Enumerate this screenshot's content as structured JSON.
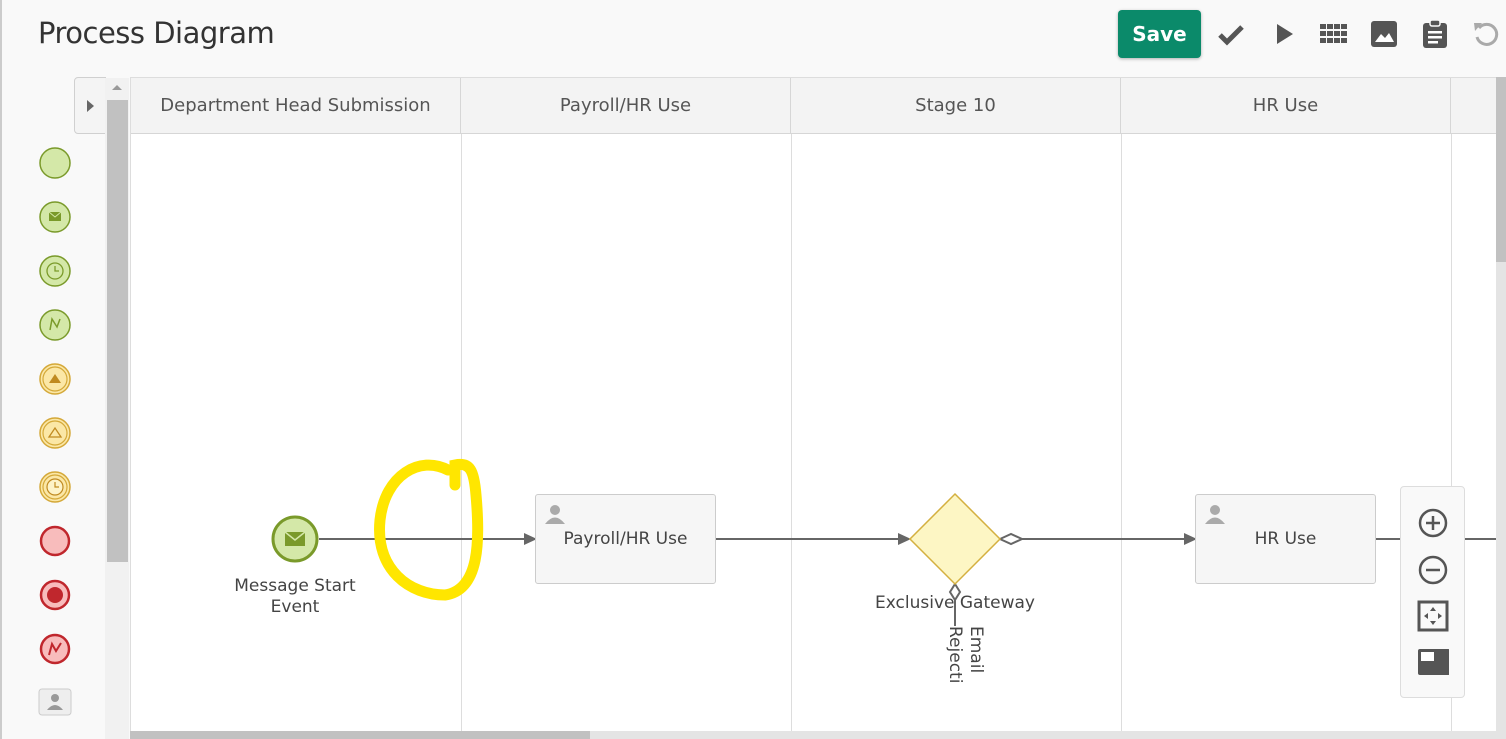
{
  "header": {
    "title": "Process Diagram",
    "save_label": "Save"
  },
  "toolbar": {
    "icons": [
      "check-icon",
      "play-icon",
      "grid-icon",
      "image-icon",
      "clipboard-icon",
      "undo-icon"
    ]
  },
  "palette": {
    "items": [
      "start-event",
      "message-start-event",
      "timer-start-event",
      "signal-start-event",
      "escalation-event-filled",
      "escalation-event",
      "timer-intermediate-event",
      "end-event",
      "terminate-end-event",
      "error-end-event",
      "user-task"
    ]
  },
  "lanes": [
    {
      "label": "Department Head Submission"
    },
    {
      "label": "Payroll/HR Use"
    },
    {
      "label": "Stage 10"
    },
    {
      "label": "HR Use"
    }
  ],
  "diagram": {
    "start_event": {
      "label_line1": "Message Start",
      "label_line2": "Event"
    },
    "task1": {
      "label": "Payroll/HR Use"
    },
    "gateway": {
      "label": "Exclusive Gateway"
    },
    "task2": {
      "label": "HR Use"
    },
    "flow_label": "Email Rejecti"
  },
  "colors": {
    "accent": "#0b8a6a",
    "highlight": "#ffe600"
  }
}
